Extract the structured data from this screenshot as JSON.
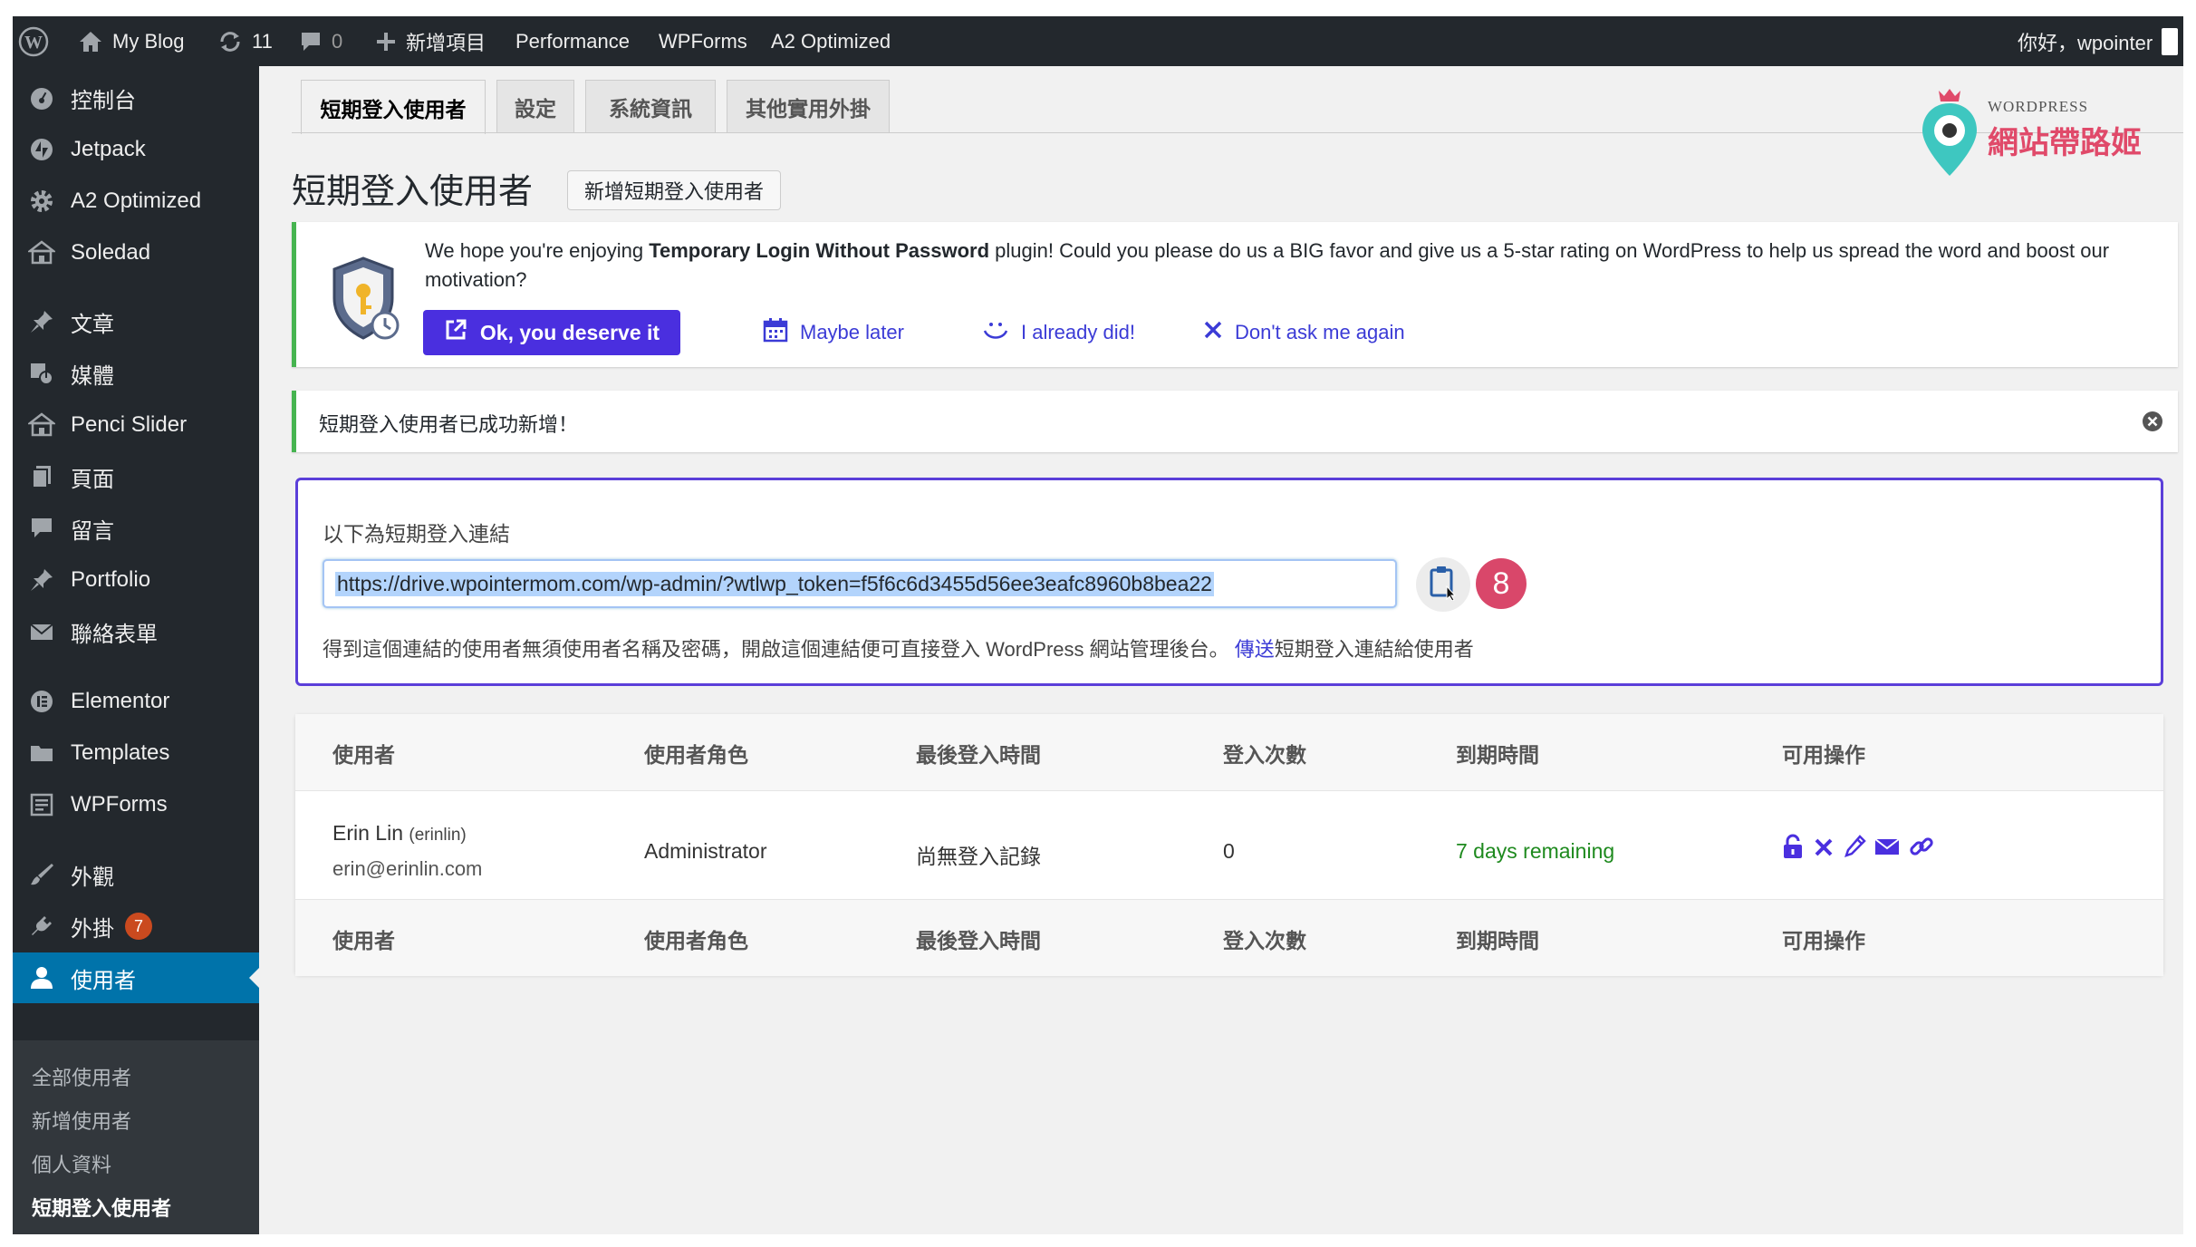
{
  "admin_bar": {
    "site_name": "My Blog",
    "updates_count": "11",
    "comments_count": "0",
    "new_item": "新增項目",
    "performance": "Performance",
    "wpforms": "WPForms",
    "a2_optimized": "A2 Optimized",
    "greeting": "你好，wpointer"
  },
  "sidebar": {
    "items": [
      {
        "label": "控制台",
        "icon": "dashboard-icon"
      },
      {
        "label": "Jetpack",
        "icon": "jetpack-icon"
      },
      {
        "label": "A2 Optimized",
        "icon": "gear-icon"
      },
      {
        "label": "Soledad",
        "icon": "home-icon"
      },
      {
        "label": "文章",
        "icon": "pin-icon"
      },
      {
        "label": "媒體",
        "icon": "media-icon"
      },
      {
        "label": "Penci Slider",
        "icon": "home-icon"
      },
      {
        "label": "頁面",
        "icon": "page-icon"
      },
      {
        "label": "留言",
        "icon": "comment-icon"
      },
      {
        "label": "Portfolio",
        "icon": "pin-icon"
      },
      {
        "label": "聯絡表單",
        "icon": "mail-icon"
      },
      {
        "label": "Elementor",
        "icon": "elementor-icon"
      },
      {
        "label": "Templates",
        "icon": "folder-icon"
      },
      {
        "label": "WPForms",
        "icon": "form-icon"
      },
      {
        "label": "外觀",
        "icon": "brush-icon"
      },
      {
        "label": "外掛",
        "icon": "plugin-icon",
        "badge": "7"
      },
      {
        "label": "使用者",
        "icon": "user-icon"
      }
    ],
    "submenu": [
      "全部使用者",
      "新增使用者",
      "個人資料",
      "短期登入使用者"
    ]
  },
  "tabs": [
    "短期登入使用者",
    "設定",
    "系統資訊",
    "其他實用外掛"
  ],
  "page": {
    "title": "短期登入使用者",
    "add_new_button": "新增短期登入使用者"
  },
  "logo": {
    "small_text": "WORDPRESS",
    "main_text": "網站帶路姬"
  },
  "review_notice": {
    "text_before": "We hope you're enjoying ",
    "plugin_name": "Temporary Login Without Password",
    "text_after": " plugin! Could you please do us a BIG favor and give us a 5-star rating on WordPress to help us spread the word and boost our motivation?",
    "ok_button": "Ok, you deserve it",
    "maybe_later": "Maybe later",
    "already_did": "I already did!",
    "dont_ask": "Don't ask me again"
  },
  "success_notice": {
    "text": "短期登入使用者已成功新增！"
  },
  "link_box": {
    "label": "以下為短期登入連結",
    "url": "https://drive.wpointermom.com/wp-admin/?wtlwp_token=f5f6c6d3455d56ee3eafc8960b8bea22",
    "step_number": "8",
    "description": "得到這個連結的使用者無須使用者名稱及密碼，開啟這個連結便可直接登入 WordPress 網站管理後台。",
    "send_link": "傳送",
    "description_suffix": "短期登入連結給使用者"
  },
  "table": {
    "columns": [
      "使用者",
      "使用者角色",
      "最後登入時間",
      "登入次數",
      "到期時間",
      "可用操作"
    ],
    "rows": [
      {
        "name": "Erin Lin",
        "username": "(erinlin)",
        "email": "erin@erinlin.com",
        "role": "Administrator",
        "last_login": "尚無登入記錄",
        "login_count": "0",
        "expiry": "7 days remaining"
      }
    ]
  },
  "colors": {
    "admin_bg": "#23282d",
    "active_menu": "#0073aa",
    "primary_button": "#4a2fdf",
    "link": "#3b3bd6",
    "success_border": "#46b450",
    "remaining_green": "#1e8a1e",
    "step_badge": "#d9476a",
    "linkbox_border": "#5b3fd9"
  }
}
